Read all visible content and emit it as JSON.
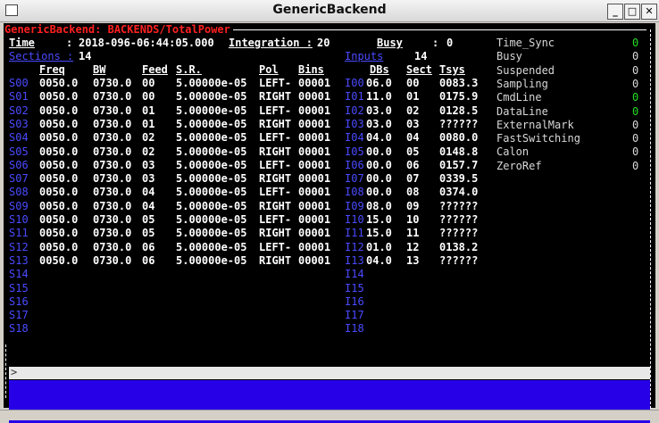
{
  "window": {
    "title": "GenericBackend"
  },
  "header": {
    "panel_title": "GenericBackend: BACKENDS/TotalPower",
    "time_label": "Time",
    "time_sep": ":",
    "time_value": "2018-096-06:44:05.000",
    "integration_label": "Integration :",
    "integration_value": "20",
    "sections_label": "Sections :",
    "sections_value": "14",
    "busy_label": "Busy",
    "busy_sep": ":",
    "busy_value": "0",
    "inputs_label": "Inputs",
    "inputs_value": "14"
  },
  "sections_table": {
    "headers": {
      "freq": "Freq",
      "bw": "BW",
      "feed": "Feed",
      "sr": "S.R.",
      "pol": "Pol",
      "bins": "Bins"
    },
    "ids": [
      "S00",
      "S01",
      "S02",
      "S03",
      "S04",
      "S05",
      "S06",
      "S07",
      "S08",
      "S09",
      "S10",
      "S11",
      "S12",
      "S13",
      "S14",
      "S15",
      "S16",
      "S17",
      "S18"
    ],
    "rows": [
      [
        "0050.0",
        "0730.0",
        "00",
        "5.00000e-05",
        "LEFT-",
        "00001"
      ],
      [
        "0050.0",
        "0730.0",
        "00",
        "5.00000e-05",
        "RIGHT",
        "00001"
      ],
      [
        "0050.0",
        "0730.0",
        "01",
        "5.00000e-05",
        "LEFT-",
        "00001"
      ],
      [
        "0050.0",
        "0730.0",
        "01",
        "5.00000e-05",
        "RIGHT",
        "00001"
      ],
      [
        "0050.0",
        "0730.0",
        "02",
        "5.00000e-05",
        "LEFT-",
        "00001"
      ],
      [
        "0050.0",
        "0730.0",
        "02",
        "5.00000e-05",
        "RIGHT",
        "00001"
      ],
      [
        "0050.0",
        "0730.0",
        "03",
        "5.00000e-05",
        "LEFT-",
        "00001"
      ],
      [
        "0050.0",
        "0730.0",
        "03",
        "5.00000e-05",
        "RIGHT",
        "00001"
      ],
      [
        "0050.0",
        "0730.0",
        "04",
        "5.00000e-05",
        "LEFT-",
        "00001"
      ],
      [
        "0050.0",
        "0730.0",
        "04",
        "5.00000e-05",
        "RIGHT",
        "00001"
      ],
      [
        "0050.0",
        "0730.0",
        "05",
        "5.00000e-05",
        "LEFT-",
        "00001"
      ],
      [
        "0050.0",
        "0730.0",
        "05",
        "5.00000e-05",
        "RIGHT",
        "00001"
      ],
      [
        "0050.0",
        "0730.0",
        "06",
        "5.00000e-05",
        "LEFT-",
        "00001"
      ],
      [
        "0050.0",
        "0730.0",
        "06",
        "5.00000e-05",
        "RIGHT",
        "00001"
      ]
    ]
  },
  "inputs_table": {
    "headers": {
      "dbs": "DBs",
      "sect": "Sect",
      "tsys": "Tsys"
    },
    "ids": [
      "I00",
      "I01",
      "I02",
      "I03",
      "I04",
      "I05",
      "I06",
      "I07",
      "I08",
      "I09",
      "I10",
      "I11",
      "I12",
      "I13",
      "I14",
      "I15",
      "I16",
      "I17",
      "I18"
    ],
    "rows": [
      [
        "06.0",
        "00",
        "0083.3"
      ],
      [
        "11.0",
        "01",
        "0175.9"
      ],
      [
        "03.0",
        "02",
        "0128.5"
      ],
      [
        "03.0",
        "03",
        "??????"
      ],
      [
        "04.0",
        "04",
        "0080.0"
      ],
      [
        "00.0",
        "05",
        "0148.8"
      ],
      [
        "00.0",
        "06",
        "0157.7"
      ],
      [
        "00.0",
        "07",
        "0339.5"
      ],
      [
        "00.0",
        "08",
        "0374.0"
      ],
      [
        "08.0",
        "09",
        "??????"
      ],
      [
        "15.0",
        "10",
        "??????"
      ],
      [
        "15.0",
        "11",
        "??????"
      ],
      [
        "01.0",
        "12",
        "0138.2"
      ],
      [
        "04.0",
        "13",
        "??????"
      ]
    ]
  },
  "status_flags": [
    {
      "name": "Time_Sync",
      "value": "0",
      "color": "#22dd22"
    },
    {
      "name": "Busy",
      "value": "0",
      "color": "#d8d8d8"
    },
    {
      "name": "Suspended",
      "value": "0",
      "color": "#d8d8d8"
    },
    {
      "name": "Sampling",
      "value": "0",
      "color": "#d8d8d8"
    },
    {
      "name": "CmdLine",
      "value": "0",
      "color": "#22dd22"
    },
    {
      "name": "DataLine",
      "value": "0",
      "color": "#22dd22"
    },
    {
      "name": "ExternalMark",
      "value": "0",
      "color": "#d8d8d8"
    },
    {
      "name": "FastSwitching",
      "value": "0",
      "color": "#d8d8d8"
    },
    {
      "name": "Calon",
      "value": "0",
      "color": "#d8d8d8"
    },
    {
      "name": "ZeroRef",
      "value": "0",
      "color": "#d8d8d8"
    }
  ],
  "command": {
    "prompt": ">",
    "value": ""
  }
}
